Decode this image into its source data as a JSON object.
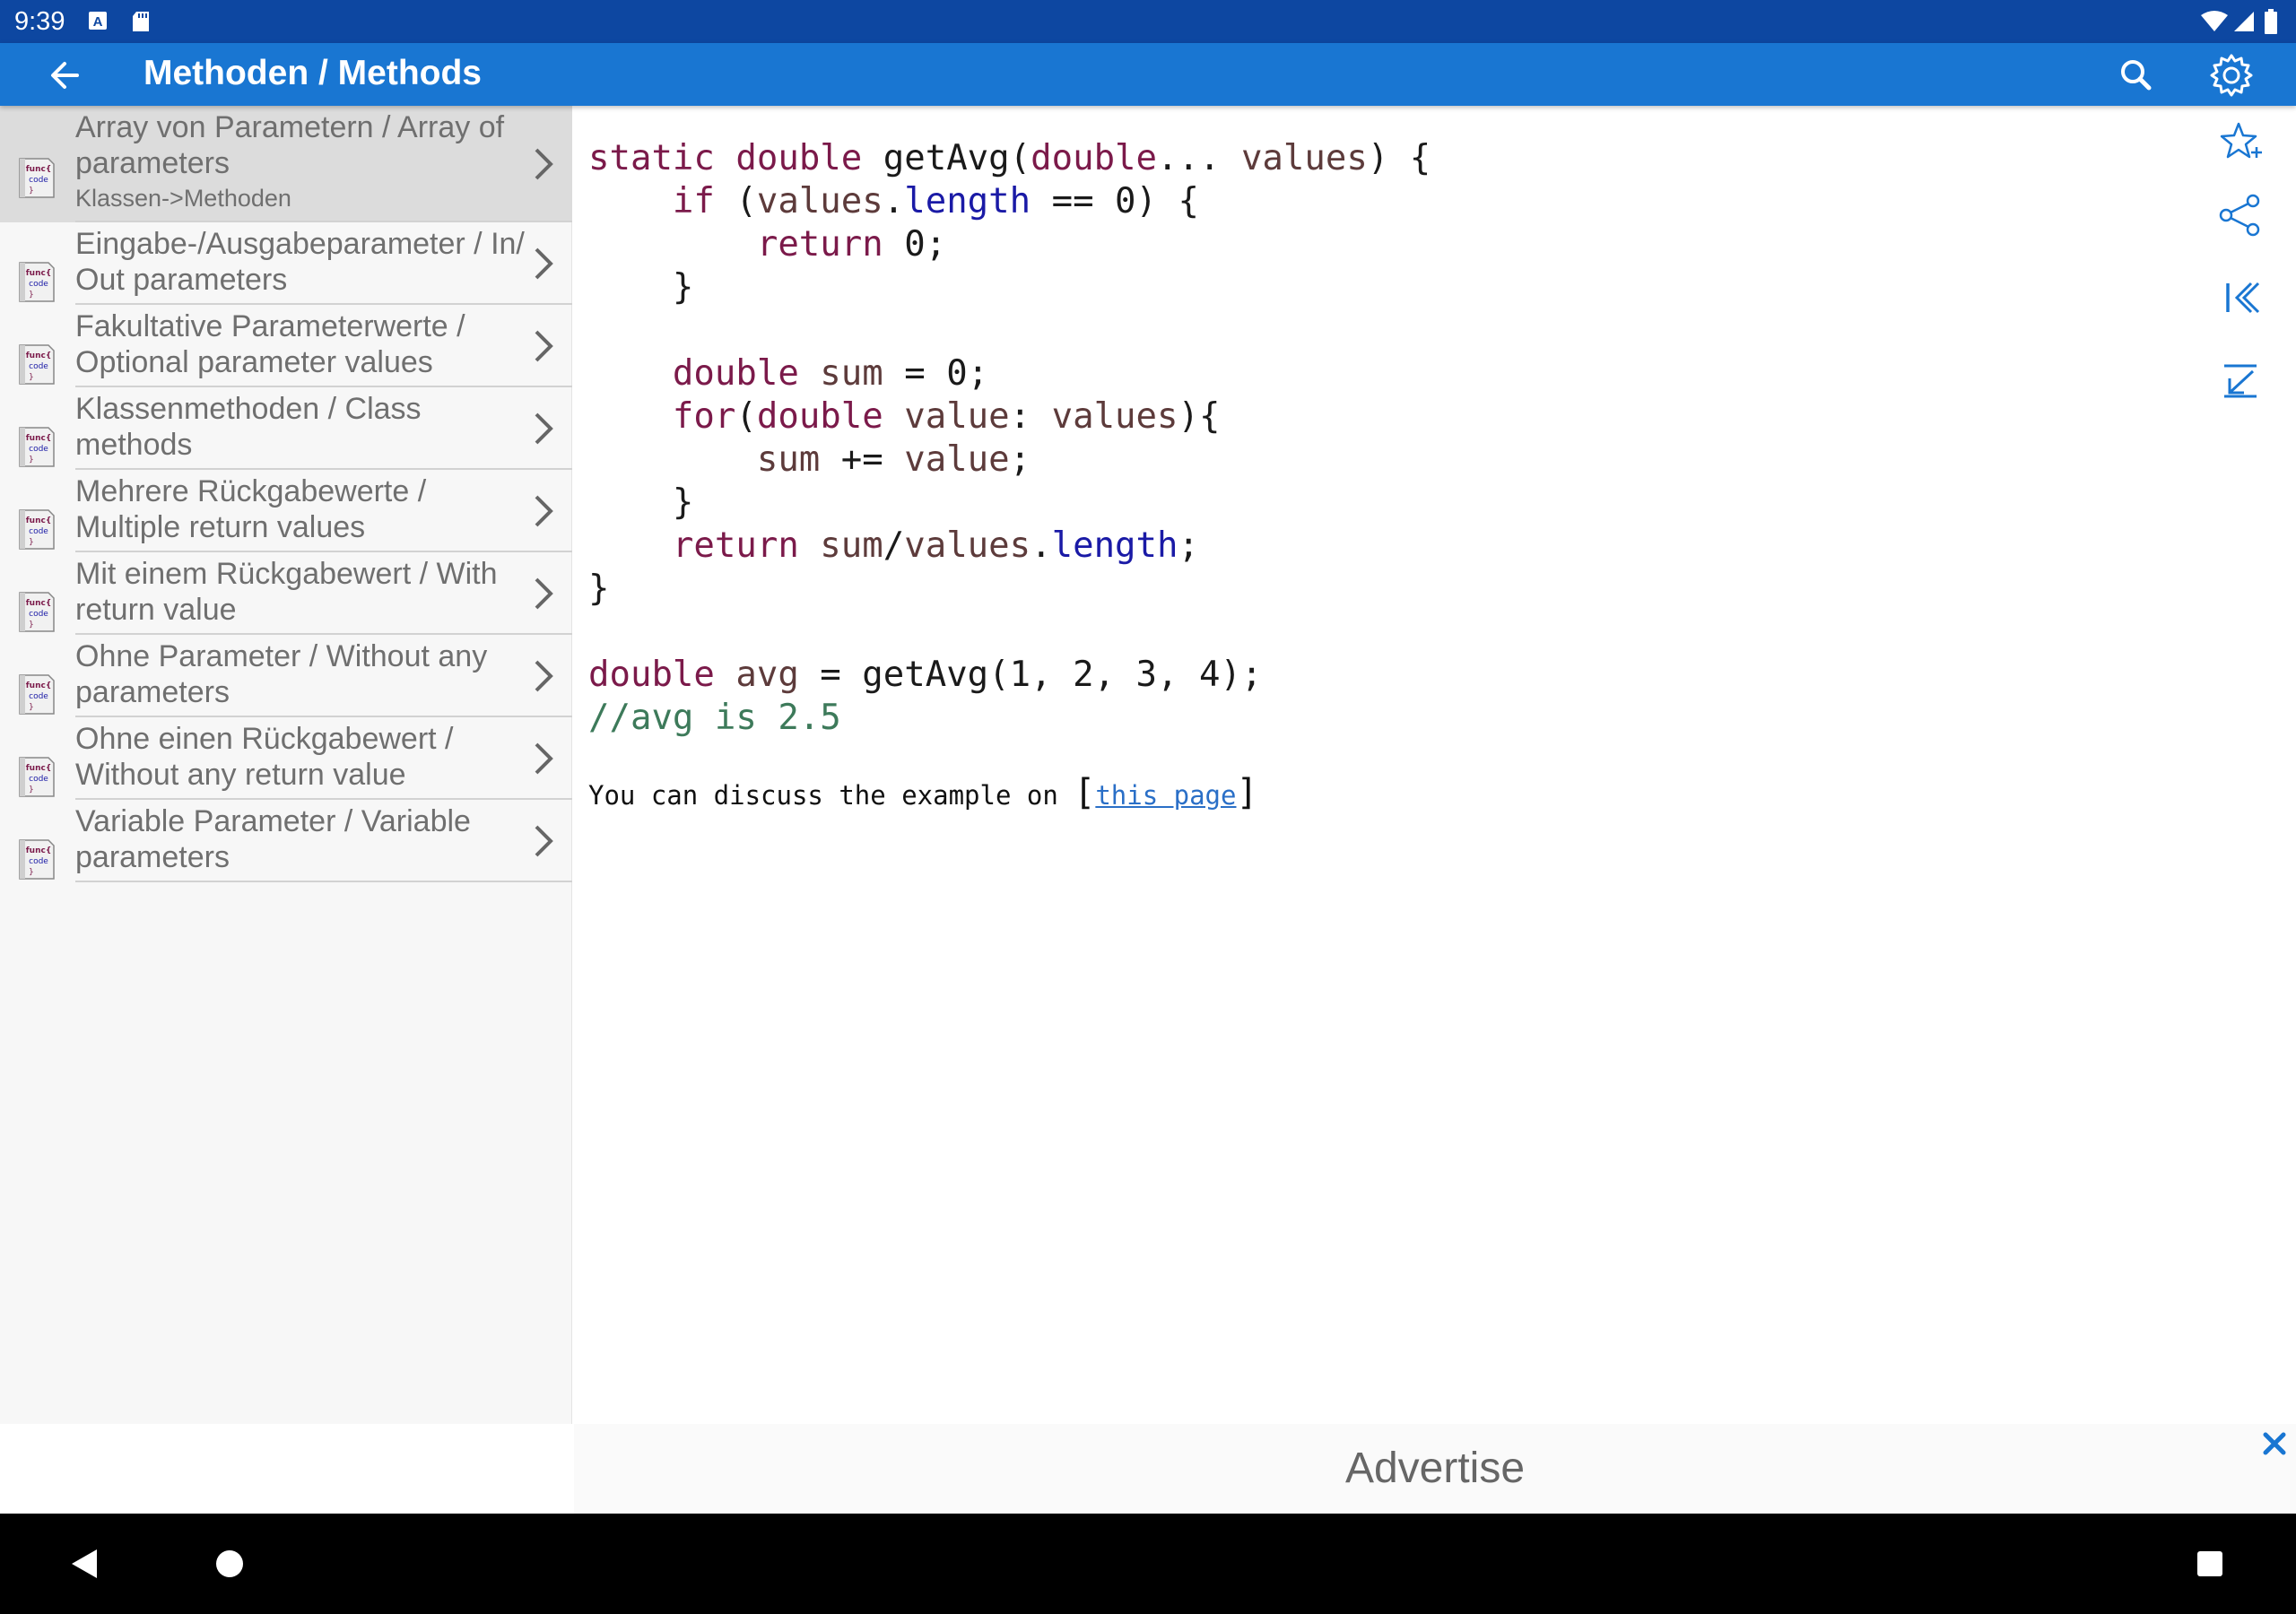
{
  "status_bar": {
    "time": "9:39",
    "left_icons": [
      "a-badge-icon",
      "sd-card-icon"
    ],
    "right_icons": [
      "wifi-icon",
      "cellular-icon",
      "battery-icon"
    ]
  },
  "app_bar": {
    "title": "Methoden / Methods",
    "back_icon": "arrow-back-icon",
    "actions": [
      "search-icon",
      "gear-icon"
    ],
    "background": "#1976d2",
    "status_background": "#0d47a1"
  },
  "sidebar": {
    "items": [
      {
        "line1": "Array von Parametern / Array of",
        "line2": "parameters",
        "sub": "Klassen->Methoden",
        "selected": true
      },
      {
        "line1": "Eingabe-/Ausgabeparameter / In/",
        "line2": "Out parameters"
      },
      {
        "line1": "Fakultative Parameterwerte /",
        "line2": "Optional parameter values"
      },
      {
        "line1": "Klassenmethoden / Class",
        "line2": "methods"
      },
      {
        "line1": "Mehrere Rückgabewerte /",
        "line2": "Multiple return values"
      },
      {
        "line1": "Mit einem Rückgabewert / With",
        "line2": "return value"
      },
      {
        "line1": "Ohne Parameter / Without any",
        "line2": "parameters"
      },
      {
        "line1": "Ohne einen Rückgabewert /",
        "line2": "Without any return value"
      },
      {
        "line1": "Variable Parameter / Variable",
        "line2": "parameters"
      }
    ],
    "item_icon": "func-code-icon"
  },
  "code": {
    "lines": [
      "static double getAvg(double... values) {",
      "    if (values.length == 0) {",
      "        return 0;",
      "    }",
      "",
      "    double sum = 0;",
      "    for(double value: values){",
      "        sum += value;",
      "    }",
      "    return sum/values.length;",
      "}",
      "",
      "double avg = getAvg(1, 2, 3, 4);",
      "//avg is 2.5"
    ],
    "discuss_text": "You can discuss the example on ",
    "discuss_link": "this page",
    "open_bracket": "[",
    "close_bracket": "]"
  },
  "rail": [
    "star-add-icon",
    "share-icon",
    "first-page-icon",
    "scroll-bottom-icon"
  ],
  "ad": {
    "label": "Advertise",
    "close_icon": "close-icon"
  },
  "nav_bar": [
    "nav-back-icon",
    "nav-home-icon",
    "nav-recents-icon"
  ],
  "colors": {
    "accent": "#1976d2",
    "keyword": "#7b1a4a",
    "property": "#1a1aa6",
    "comment": "#3d7a5a",
    "link": "#2a6fc7"
  }
}
